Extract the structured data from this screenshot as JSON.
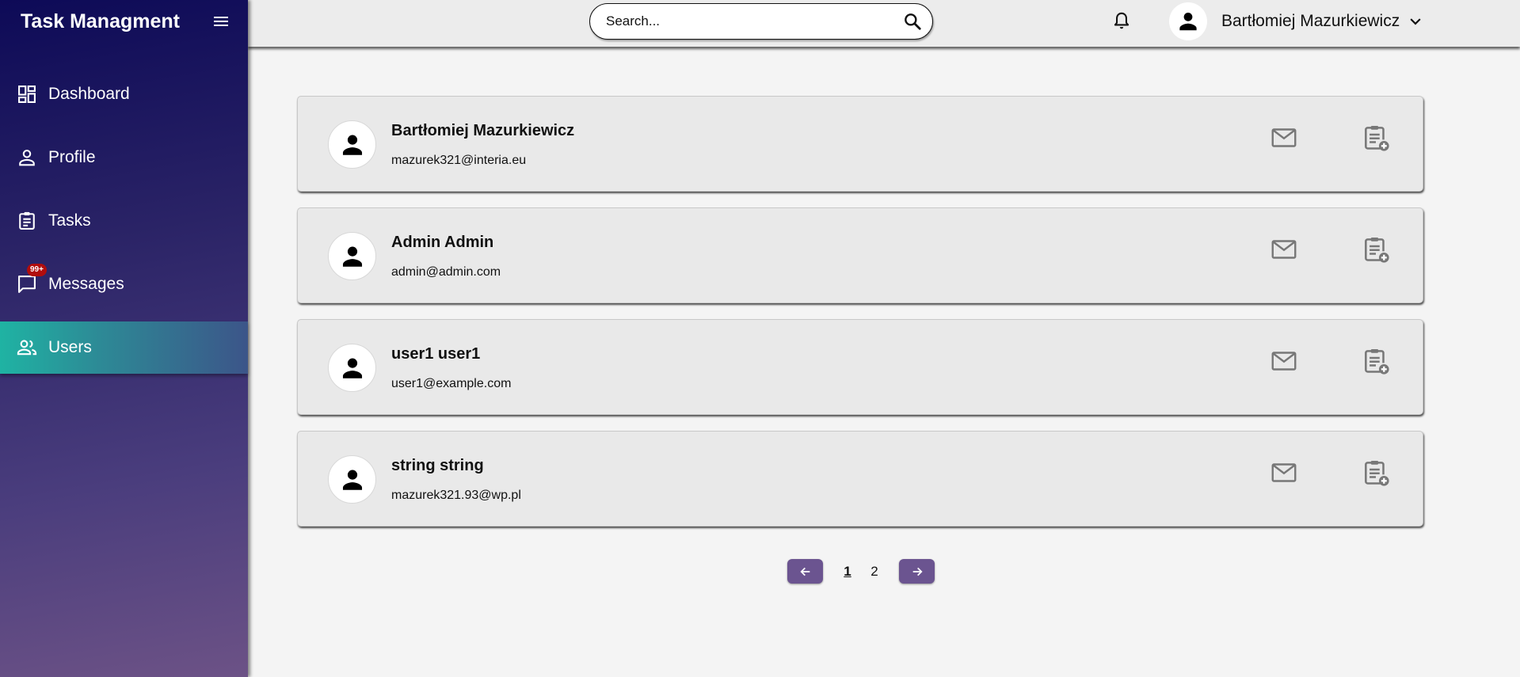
{
  "app": {
    "title": "Task Managment"
  },
  "sidebar": {
    "items": [
      {
        "label": "Dashboard",
        "icon": "dashboard-icon"
      },
      {
        "label": "Profile",
        "icon": "person-icon"
      },
      {
        "label": "Tasks",
        "icon": "clipboard-icon"
      },
      {
        "label": "Messages",
        "icon": "chat-icon",
        "badge": "99+"
      },
      {
        "label": "Users",
        "icon": "users-icon",
        "active": true
      }
    ]
  },
  "topbar": {
    "search_placeholder": "Search...",
    "user_name": "Bartłomiej Mazurkiewicz"
  },
  "users": [
    {
      "name": "Bartłomiej Mazurkiewicz",
      "email": "mazurek321@interia.eu"
    },
    {
      "name": "Admin Admin",
      "email": "admin@admin.com"
    },
    {
      "name": "user1 user1",
      "email": "user1@example.com"
    },
    {
      "name": "string string",
      "email": "mazurek321.93@wp.pl"
    }
  ],
  "pagination": {
    "pages": [
      "1",
      "2"
    ],
    "current": "1"
  },
  "colors": {
    "accent": "#6b5490",
    "active_nav": "#1fb3a3",
    "badge": "#b10d0d"
  }
}
